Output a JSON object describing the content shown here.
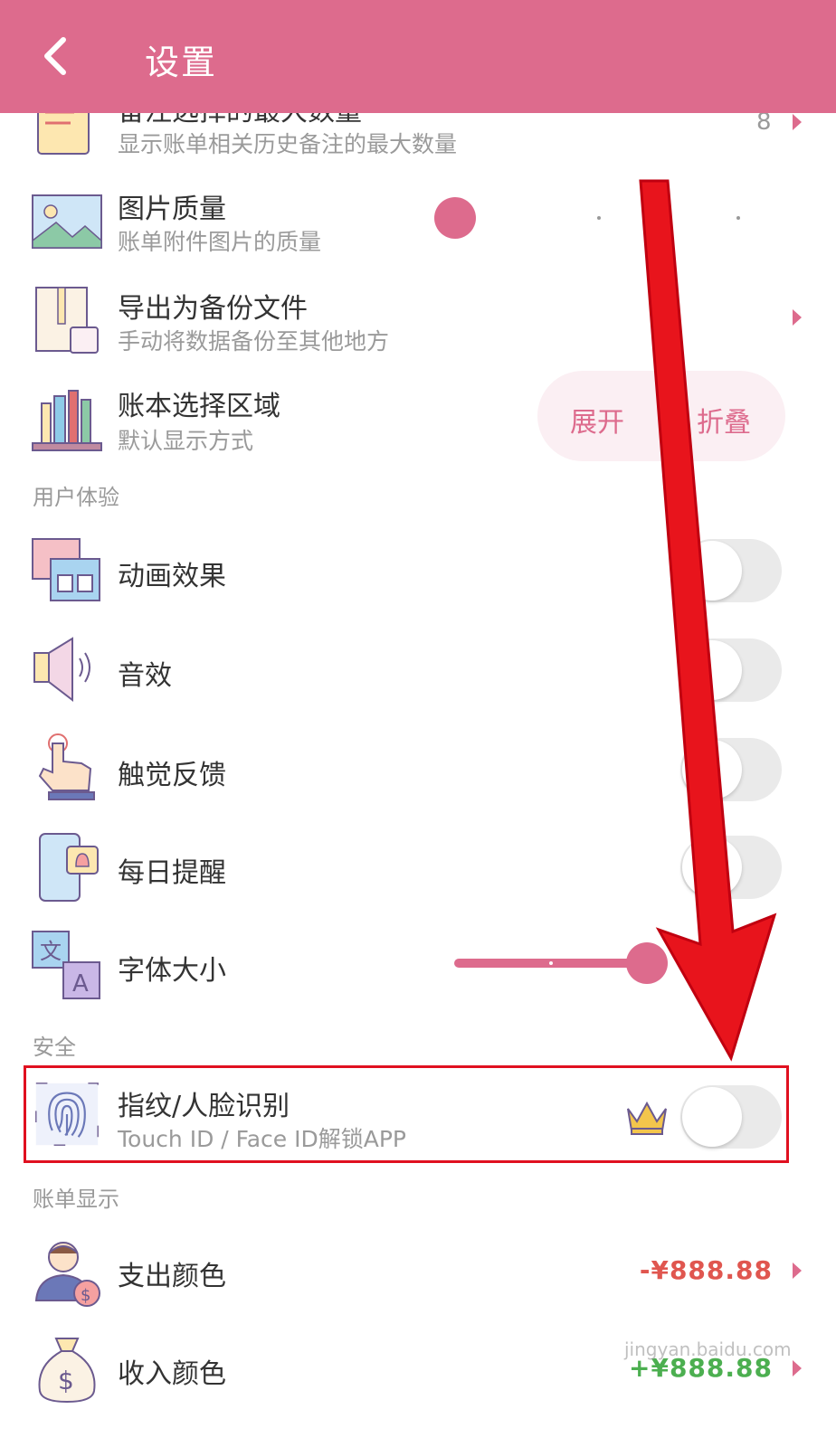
{
  "header": {
    "title": "设置"
  },
  "rows": {
    "backup_notes": {
      "label": "备注选择的最大数量",
      "sub": "显示账单相关历史备注的最大数量",
      "value": "8"
    },
    "image_quality": {
      "label": "图片质量",
      "sub": "账单附件图片的质量",
      "slider_level": 0
    },
    "export_backup": {
      "label": "导出为备份文件",
      "sub": "手动将数据备份至其他地方"
    },
    "book_area": {
      "label": "账本选择区域",
      "sub": "默认显示方式",
      "options": [
        "展开",
        "折叠"
      ]
    },
    "animation": {
      "label": "动画效果",
      "on": false
    },
    "sound": {
      "label": "音效",
      "on": false
    },
    "haptic": {
      "label": "触觉反馈",
      "on": false
    },
    "reminder": {
      "label": "每日提醒",
      "on": false
    },
    "font_size": {
      "label": "字体大小",
      "slider_level": 1
    },
    "biometric": {
      "label": "指纹/人脸识别",
      "sub": "Touch ID / Face ID解锁APP",
      "on": false
    },
    "expense_color": {
      "label": "支出颜色",
      "amount": "-¥888.88",
      "color": "#e0564f"
    },
    "income_color": {
      "label": "收入颜色",
      "amount": "+¥888.88",
      "color": "#4caf50"
    }
  },
  "sections": {
    "ux": "用户体验",
    "security": "安全",
    "bill_display": "账单显示"
  },
  "colors": {
    "accent": "#dd6b8d",
    "highlight": "#e01020"
  },
  "watermark": "jingyan.baidu.com"
}
